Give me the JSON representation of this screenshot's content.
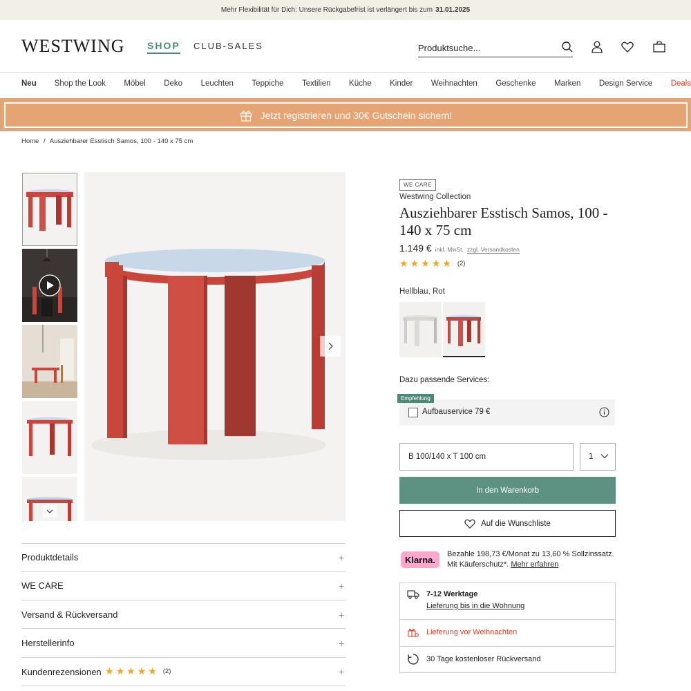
{
  "announcement": {
    "text": "Mehr Flexibilität für Dich: Unsere Rückgabefrist ist verlängert bis zum",
    "date": "31.01.2025"
  },
  "header": {
    "logo": "WESTWING",
    "tabs": [
      "SHOP",
      "CLUB-SALES"
    ],
    "search_placeholder": "Produktsuche..."
  },
  "nav": [
    "Neu",
    "Shop the Look",
    "Möbel",
    "Deko",
    "Leuchten",
    "Teppiche",
    "Textilien",
    "Küche",
    "Kinder",
    "Weihnachten",
    "Geschenke",
    "Marken",
    "Design Service",
    "Deals"
  ],
  "promo": {
    "text": "Jetzt registrieren und 30€ Gutschein sichern!"
  },
  "breadcrumb": {
    "home": "Home",
    "sep": "/",
    "current": "Ausziehbarer Esstisch Samos, 100 - 140 x 75 cm"
  },
  "product": {
    "badge": "WE CARE",
    "brand": "Westwing Collection",
    "title": "Ausziehbarer Esstisch Samos, 100 - 140 x 75 cm",
    "price": "1.149 €",
    "price_note": "inkl. MwSt.",
    "shipping_link": "zzgl. Versandkosten",
    "rating": 5,
    "review_count": "(2)",
    "variant": "Hellblau, Rot",
    "colors": {
      "top": "#c9d8e8",
      "red": "#c8463c"
    }
  },
  "services": {
    "label": "Dazu passende Services:",
    "badge": "Empfehlung",
    "option": "Aufbauservice 79 €"
  },
  "size_select": "B 100/140 x T 100 cm",
  "qty": "1",
  "cart_button": "In den Warenkorb",
  "wishlist_button": "Auf die Wunschliste",
  "klarna": {
    "logo": "Klarna.",
    "text": "Bezahle 198,73 €/Monat zu 13,60 % Sollzinssatz. Mit Käuferschutz*.",
    "link": "Mehr erfahren"
  },
  "delivery": {
    "time": "7-12 Werktage",
    "time_link": "Lieferung bis in die Wohnung",
    "xmas": "Lieferung vor Weihnachten",
    "returns": "30 Tage kostenloser Rückversand"
  },
  "accordions": [
    "Produktdetails",
    "WE CARE",
    "Versand & Rückversand",
    "Herstellerinfo",
    "Kundenrezensionen"
  ],
  "accordion_review_count": "(2)"
}
